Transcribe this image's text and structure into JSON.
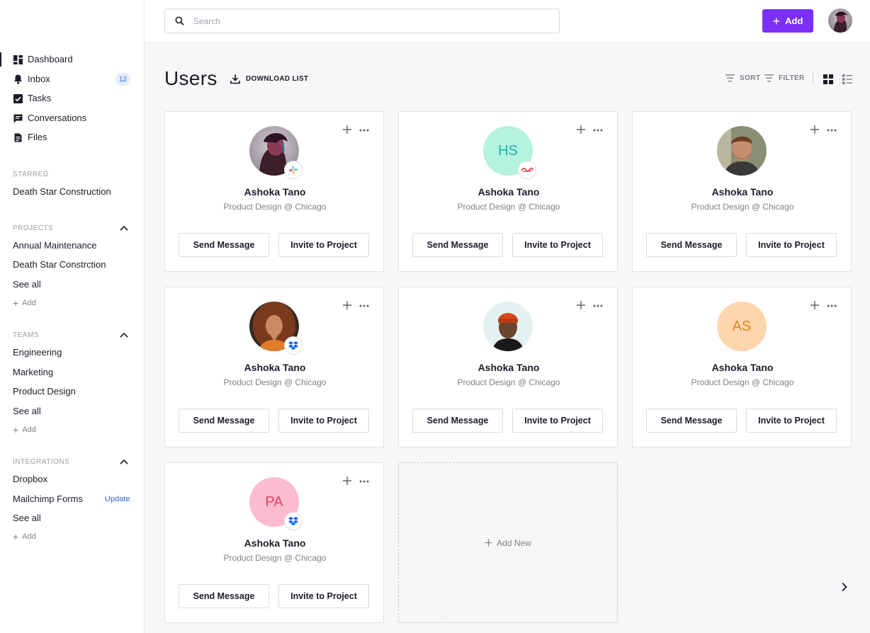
{
  "sidebar": {
    "nav": [
      {
        "label": "Dashboard",
        "icon": "dashboard-icon"
      },
      {
        "label": "Inbox",
        "icon": "bell-icon",
        "badge": "12"
      },
      {
        "label": "Tasks",
        "icon": "checkbox-icon"
      },
      {
        "label": "Conversations",
        "icon": "chat-icon"
      },
      {
        "label": "Files",
        "icon": "file-icon"
      }
    ],
    "starred": {
      "title": "STARRED",
      "items": [
        "Death Star Construction"
      ]
    },
    "projects": {
      "title": "PROJECTS",
      "items": [
        "Annual Maintenance",
        "Death Star Constrction"
      ],
      "see_all": "See all",
      "add": "Add"
    },
    "teams": {
      "title": "TEAMS",
      "items": [
        "Engineering",
        "Marketing",
        "Product Design"
      ],
      "see_all": "See all",
      "add": "Add"
    },
    "integrations": {
      "title": "INTEGRATIONS",
      "items": [
        "Dropbox",
        "Mailchimp Forms"
      ],
      "update": "Update",
      "see_all": "See all",
      "add": "Add"
    }
  },
  "topbar": {
    "search_placeholder": "Search",
    "add_label": "Add"
  },
  "header": {
    "title": "Users",
    "download": "DOWNLOAD LIST",
    "sort": "SORT",
    "filter": "FILTER"
  },
  "cards": [
    {
      "name": "Ashoka Tano",
      "role": "Product Design @ Chicago",
      "send": "Send Message",
      "invite": "Invite to Project",
      "avatar": "photo",
      "brand": "slack-icon"
    },
    {
      "name": "Ashoka Tano",
      "role": "Product Design @ Chicago",
      "send": "Send Message",
      "invite": "Invite to Project",
      "avatar": "initials",
      "initials": "HS",
      "brand": "coca-cola-icon"
    },
    {
      "name": "Ashoka Tano",
      "role": "Product Design @ Chicago",
      "send": "Send Message",
      "invite": "Invite to Project",
      "avatar": "photo"
    },
    {
      "name": "Ashoka Tano",
      "role": "Product Design @ Chicago",
      "send": "Send Message",
      "invite": "Invite to Project",
      "avatar": "photo",
      "brand": "dropbox-icon"
    },
    {
      "name": "Ashoka Tano",
      "role": "Product Design @ Chicago",
      "send": "Send Message",
      "invite": "Invite to Project",
      "avatar": "photo"
    },
    {
      "name": "Ashoka Tano",
      "role": "Product Design @ Chicago",
      "send": "Send Message",
      "invite": "Invite to Project",
      "avatar": "initials",
      "initials": "AS"
    },
    {
      "name": "Ashoka Tano",
      "role": "Product Design @ Chicago",
      "send": "Send Message",
      "invite": "Invite to Project",
      "avatar": "initials",
      "initials": "PA",
      "brand": "dropbox-icon"
    }
  ],
  "add_new": "Add New",
  "colors": {
    "accent": "#7b2ff7",
    "link": "#2d6ad3",
    "hs_bg": "#b5f2df",
    "hs_fg": "#18b6a8",
    "as_bg": "#fdd6ae",
    "as_fg": "#e2861f",
    "pa_bg": "#fbbcd0",
    "pa_fg": "#e2455e"
  }
}
